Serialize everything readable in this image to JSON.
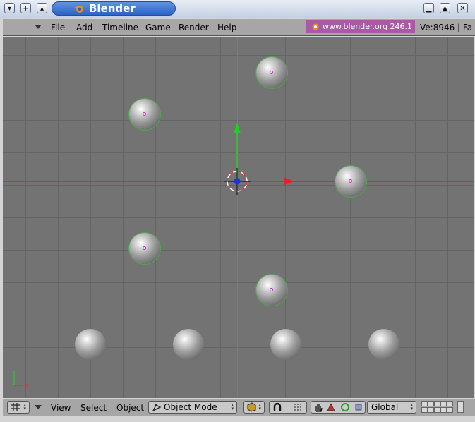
{
  "window": {
    "title": "Blender",
    "controls": {
      "left": [
        "chevron-down-icon",
        "plus-icon",
        "eject-icon"
      ],
      "right": [
        "minimize-icon",
        "maximize-icon",
        "close-icon"
      ]
    },
    "close_glyph": "✕"
  },
  "header": {
    "menu": [
      "File",
      "Add",
      "Timeline",
      "Game",
      "Render",
      "Help"
    ],
    "banner_text": "www.blender.org 246.1",
    "stats_text": "Ve:8946 | Fa"
  },
  "viewport": {
    "grid_color": "#646464",
    "background_color": "#737373",
    "x_axis_color": "#d03030",
    "y_axis_color": "#3aa83a",
    "object_count": 9,
    "selected_object_count": 5,
    "axis_labels": {
      "x": "x"
    }
  },
  "footer": {
    "view_menu": [
      "View",
      "Select",
      "Object"
    ],
    "mode": "Object Mode",
    "orientation": "Global",
    "icons": [
      "view-grid-icon",
      "shading-icon",
      "snap-magnet-icon",
      "snap-options-icon",
      "hand-icon",
      "triangle-icon",
      "circle-icon",
      "square-icon"
    ]
  },
  "colors": {
    "title_bar_accent": "#2c64c8",
    "banner": "#a85aa6",
    "menu_bg": "#a6a6a6"
  }
}
